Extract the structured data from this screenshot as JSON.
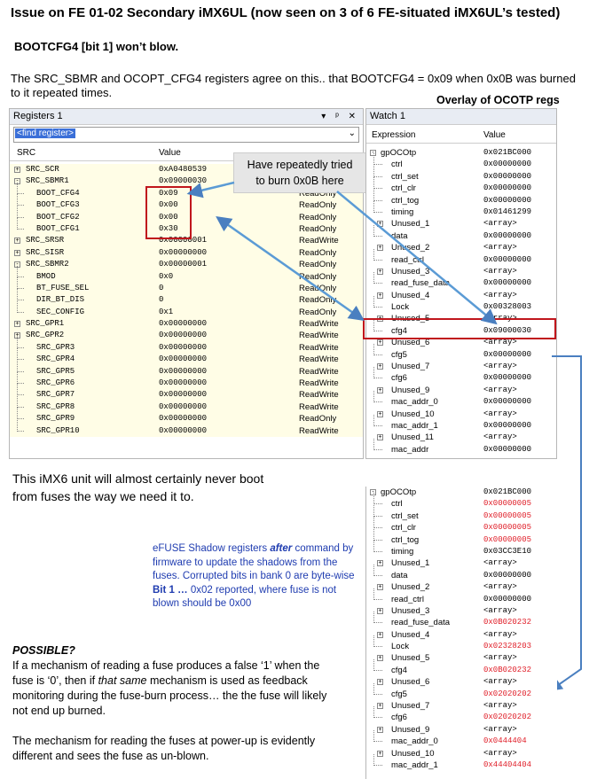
{
  "title": "Issue on FE  01-02  Secondary iMX6UL    (now seen on 3 of 6  FE-situated iMX6UL’s tested)",
  "subtitle": "BOOTCFG4 [bit 1] won’t blow.",
  "intro": "The SRC_SBMR and OCOPT_CFG4 registers agree on this..  that BOOTCFG4 = 0x09 when  0x0B was burned to it repeated times.",
  "overlay_label": "Overlay of OCOTP regs",
  "registers_panel": {
    "title": "Registers 1",
    "title_buttons": "▾ ᵖ ✕",
    "find_placeholder": "<find register>",
    "col_name": "SRC",
    "col_value": "Value",
    "rows": [
      {
        "pm": "+",
        "name": "SRC_SCR",
        "value": "0xA0480539",
        "access": ""
      },
      {
        "pm": "-",
        "name": "SRC_SBMR1",
        "value": "0x09000030",
        "access": ""
      },
      {
        "pm": "",
        "name": "BOOT_CFG4",
        "value": "0x09",
        "access": "ReadOnly"
      },
      {
        "pm": "",
        "name": "BOOT_CFG3",
        "value": "0x00",
        "access": "ReadOnly"
      },
      {
        "pm": "",
        "name": "BOOT_CFG2",
        "value": "0x00",
        "access": "ReadOnly"
      },
      {
        "pm": "",
        "name": "BOOT_CFG1",
        "value": "0x30",
        "access": "ReadOnly"
      },
      {
        "pm": "+",
        "name": "SRC_SRSR",
        "value": "0x00000001",
        "access": "ReadWrite"
      },
      {
        "pm": "+",
        "name": "SRC_SISR",
        "value": "0x00000000",
        "access": "ReadOnly"
      },
      {
        "pm": "-",
        "name": "SRC_SBMR2",
        "value": "0x00000001",
        "access": "ReadOnly"
      },
      {
        "pm": "",
        "name": "BMOD",
        "value": "0x0",
        "access": "ReadOnly"
      },
      {
        "pm": "",
        "name": "BT_FUSE_SEL",
        "value": "0",
        "access": "ReadOnly"
      },
      {
        "pm": "",
        "name": "DIR_BT_DIS",
        "value": "0",
        "access": "ReadOnly"
      },
      {
        "pm": "",
        "name": "SEC_CONFIG",
        "value": "0x1",
        "access": "ReadOnly"
      },
      {
        "pm": "+",
        "name": "SRC_GPR1",
        "value": "0x00000000",
        "access": "ReadWrite"
      },
      {
        "pm": "+",
        "name": "SRC_GPR2",
        "value": "0x00000000",
        "access": "ReadWrite"
      },
      {
        "pm": "",
        "name": "SRC_GPR3",
        "value": "0x00000000",
        "access": "ReadWrite"
      },
      {
        "pm": "",
        "name": "SRC_GPR4",
        "value": "0x00000000",
        "access": "ReadWrite"
      },
      {
        "pm": "",
        "name": "SRC_GPR5",
        "value": "0x00000000",
        "access": "ReadWrite"
      },
      {
        "pm": "",
        "name": "SRC_GPR6",
        "value": "0x00000000",
        "access": "ReadWrite"
      },
      {
        "pm": "",
        "name": "SRC_GPR7",
        "value": "0x00000000",
        "access": "ReadWrite"
      },
      {
        "pm": "",
        "name": "SRC_GPR8",
        "value": "0x00000000",
        "access": "ReadWrite"
      },
      {
        "pm": "",
        "name": "SRC_GPR9",
        "value": "0x00000000",
        "access": "ReadOnly"
      },
      {
        "pm": "",
        "name": "SRC_GPR10",
        "value": "0x00000000",
        "access": "ReadWrite"
      }
    ]
  },
  "callout": "Have repeatedly tried to burn 0x0B here",
  "watch_panel": {
    "title": "Watch 1",
    "col_expr": "Expression",
    "col_value": "Value",
    "rows": [
      {
        "pm": "-",
        "name": "gpOCOtp",
        "value": "0x021BC000"
      },
      {
        "pm": "",
        "name": "ctrl",
        "value": "0x00000000"
      },
      {
        "pm": "",
        "name": "ctrl_set",
        "value": "0x00000000"
      },
      {
        "pm": "",
        "name": "ctrl_clr",
        "value": "0x00000000"
      },
      {
        "pm": "",
        "name": "ctrl_tog",
        "value": "0x00000000"
      },
      {
        "pm": "",
        "name": "timing",
        "value": "0x01461299"
      },
      {
        "pm": "+",
        "name": "Unused_1",
        "value": "<array>"
      },
      {
        "pm": "",
        "name": "data",
        "value": "0x00000000"
      },
      {
        "pm": "+",
        "name": "Unused_2",
        "value": "<array>"
      },
      {
        "pm": "",
        "name": "read_ctrl",
        "value": "0x00000000"
      },
      {
        "pm": "+",
        "name": "Unused_3",
        "value": "<array>"
      },
      {
        "pm": "",
        "name": "read_fuse_data",
        "value": "0x00000000"
      },
      {
        "pm": "+",
        "name": "Unused_4",
        "value": "<array>"
      },
      {
        "pm": "",
        "name": "Lock",
        "value": "0x00328003"
      },
      {
        "pm": "+",
        "name": "Unused_5",
        "value": "<array>"
      },
      {
        "pm": "",
        "name": "cfg4",
        "value": "0x09000030"
      },
      {
        "pm": "+",
        "name": "Unused_6",
        "value": "<array>"
      },
      {
        "pm": "",
        "name": "cfg5",
        "value": "0x00000000"
      },
      {
        "pm": "+",
        "name": "Unused_7",
        "value": "<array>"
      },
      {
        "pm": "",
        "name": "cfg6",
        "value": "0x00000000"
      },
      {
        "pm": "+",
        "name": "Unused_9",
        "value": "<array>"
      },
      {
        "pm": "",
        "name": "mac_addr_0",
        "value": "0x00000000"
      },
      {
        "pm": "+",
        "name": "Unused_10",
        "value": "<array>"
      },
      {
        "pm": "",
        "name": "mac_addr_1",
        "value": "0x00000000"
      },
      {
        "pm": "+",
        "name": "Unused_11",
        "value": "<array>"
      },
      {
        "pm": "",
        "name": "mac_addr",
        "value": "0x00000000"
      }
    ]
  },
  "watch2": {
    "rows": [
      {
        "pm": "-",
        "name": "gpOCOtp",
        "value": "0x021BC000",
        "red": false
      },
      {
        "pm": "",
        "name": "ctrl",
        "value": "0x00000005",
        "red": true
      },
      {
        "pm": "",
        "name": "ctrl_set",
        "value": "0x00000005",
        "red": true
      },
      {
        "pm": "",
        "name": "ctrl_clr",
        "value": "0x00000005",
        "red": true
      },
      {
        "pm": "",
        "name": "ctrl_tog",
        "value": "0x00000005",
        "red": true
      },
      {
        "pm": "",
        "name": "timing",
        "value": "0x03CC3E10",
        "red": false
      },
      {
        "pm": "+",
        "name": "Unused_1",
        "value": "<array>",
        "red": false
      },
      {
        "pm": "",
        "name": "data",
        "value": "0x00000000",
        "red": false
      },
      {
        "pm": "+",
        "name": "Unused_2",
        "value": "<array>",
        "red": false
      },
      {
        "pm": "",
        "name": "read_ctrl",
        "value": "0x00000000",
        "red": false
      },
      {
        "pm": "+",
        "name": "Unused_3",
        "value": "<array>",
        "red": false
      },
      {
        "pm": "",
        "name": "read_fuse_data",
        "value": "0x0B020232",
        "red": true
      },
      {
        "pm": "+",
        "name": "Unused_4",
        "value": "<array>",
        "red": false
      },
      {
        "pm": "",
        "name": "Lock",
        "value": "0x02328203",
        "red": true
      },
      {
        "pm": "+",
        "name": "Unused_5",
        "value": "<array>",
        "red": false
      },
      {
        "pm": "",
        "name": "cfg4",
        "value": "0x0B020232",
        "red": true
      },
      {
        "pm": "+",
        "name": "Unused_6",
        "value": "<array>",
        "red": false
      },
      {
        "pm": "",
        "name": "cfg5",
        "value": "0x02020202",
        "red": true
      },
      {
        "pm": "+",
        "name": "Unused_7",
        "value": "<array>",
        "red": false
      },
      {
        "pm": "",
        "name": "cfg6",
        "value": "0x02020202",
        "red": true
      },
      {
        "pm": "+",
        "name": "Unused_9",
        "value": "<array>",
        "red": false
      },
      {
        "pm": "",
        "name": "mac_addr_0",
        "value": "0x0444404",
        "red": true
      },
      {
        "pm": "+",
        "name": "Unused_10",
        "value": "<array>",
        "red": false
      },
      {
        "pm": "",
        "name": "mac_addr_1",
        "value": "0x44404404",
        "red": true
      }
    ]
  },
  "never_boot": "This iMX6 unit will almost certainly never boot from fuses the way we need it to.",
  "efuse_note": {
    "p1": "eFUSE Shadow registers ",
    "em": "after",
    "p2": " command by firmware to update the shadows from the fuses.   Corrupted bits in bank 0 are byte-wise  ",
    "b": "Bit 1 …",
    "p3": " 0x02 reported, where fuse is not blown should be 0x00"
  },
  "possible": {
    "heading": "POSSIBLE?",
    "p1": "If a mechanism of reading a fuse produces a false ‘1’ when the fuse is ‘0’, then if ",
    "em": "that same",
    "p2": " mechanism is used as feedback monitoring during the fuse-burn process…  the the fuse will likely not end up burned.",
    "p3": "The mechanism for reading the fuses at power-up is evidently different and sees the fuse as un-blown."
  }
}
